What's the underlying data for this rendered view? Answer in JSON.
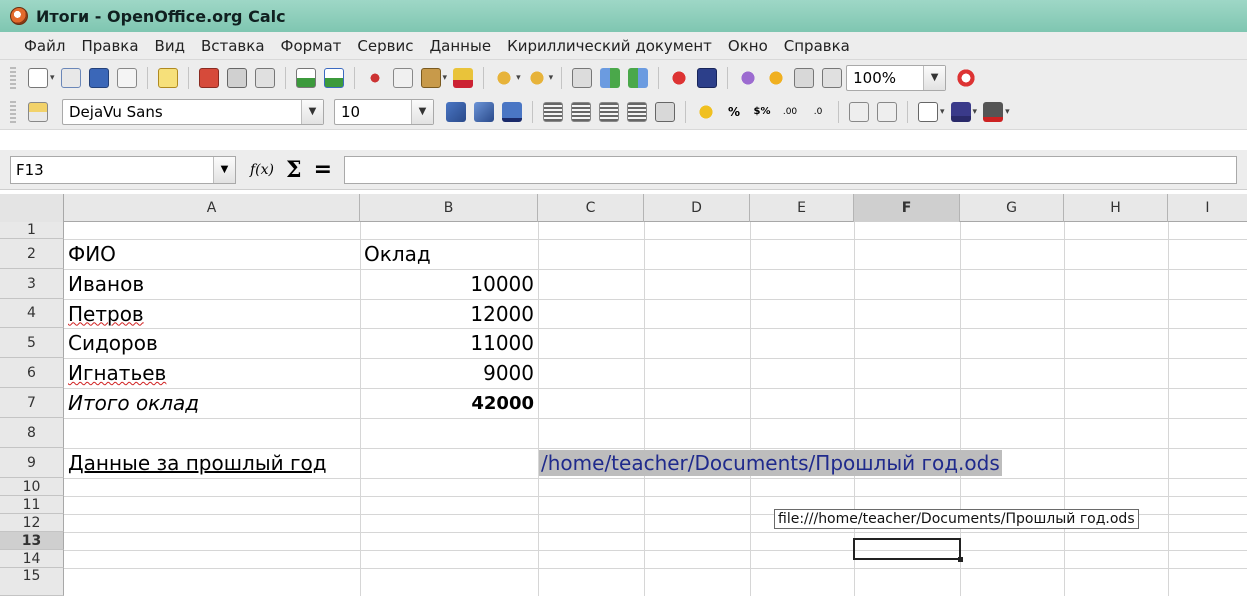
{
  "window": {
    "title": "Итоги - OpenOffice.org Calc"
  },
  "menubar": {
    "items": [
      "Файл",
      "Правка",
      "Вид",
      "Вставка",
      "Формат",
      "Сервис",
      "Данные",
      "Кириллический документ",
      "Окно",
      "Справка"
    ]
  },
  "toolbar": {
    "zoom": "100%",
    "font_name": "DejaVu Sans",
    "font_size": "10",
    "icons": [
      "new-icon",
      "templates-icon",
      "save-icon",
      "email-icon",
      "edit-mode-icon",
      "export-pdf-icon",
      "print-icon",
      "page-preview-icon",
      "spellcheck-icon",
      "autospell-icon",
      "cut-icon",
      "copy-icon",
      "paste-icon",
      "clone-format-icon",
      "undo-icon",
      "redo-icon",
      "chart-icon",
      "sort-ascending-icon",
      "sort-descending-icon",
      "draw-icon",
      "navigator-icon",
      "gallery-icon",
      "datasource-icon",
      "help-icon"
    ]
  },
  "formula_bar": {
    "name_box": "F13",
    "fx_label": "f(x)",
    "sum_label": "Σ",
    "eq_label": "="
  },
  "sheet": {
    "columns": [
      "A",
      "B",
      "C",
      "D",
      "E",
      "F",
      "G",
      "H",
      "I"
    ],
    "selected_column": "F",
    "rows": [
      "1",
      "2",
      "3",
      "4",
      "5",
      "6",
      "7",
      "8",
      "9",
      "10",
      "11",
      "12",
      "13",
      "14",
      "15"
    ],
    "selected_row": "13",
    "cells": {
      "A2": "ФИО",
      "B2": "Оклад",
      "A3": "Иванов",
      "B3": "10000",
      "A4": "Петров",
      "B4": "12000",
      "A5": "Сидоров",
      "B5": "11000",
      "A6": "Игнатьев",
      "B6": "9000",
      "A7": "Итого оклад",
      "B7": "42000",
      "A9": "Данные за прошлый год",
      "C9": "/home/teacher/Documents/Прошлый год.ods"
    },
    "tooltip": "file:///home/teacher/Documents/Прошлый год.ods"
  },
  "colors": {
    "titlebar": "#8ccfbb",
    "chrome": "#ededed",
    "hyperlink": "#1f2a8c",
    "hyperlink_bg": "#bdbdbd"
  }
}
